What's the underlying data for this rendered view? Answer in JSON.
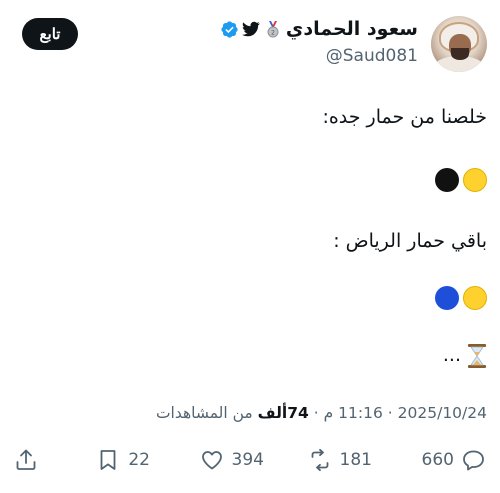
{
  "author": {
    "display_name": "سعود الحمادي",
    "handle": "@Saud081"
  },
  "follow_label": "تابع",
  "tweet": {
    "line1": "خلصنا من حمار جده:",
    "line2": "باقي حمار الرياض :",
    "line3": "..."
  },
  "meta": {
    "time": "11:16 م",
    "separator": "·",
    "date": "2025/10/24",
    "views_count": "74ألف",
    "views_label": "من المشاهدات"
  },
  "actions": {
    "replies": "660",
    "retweets": "181",
    "likes": "394",
    "bookmarks": "22"
  },
  "colors": {
    "text": "#0f1419",
    "secondary": "#536471",
    "verified": "#1d9bf0",
    "button_bg": "#0f1419"
  },
  "icons": [
    "verified-badge-icon",
    "twitter-bird-icon",
    "silver-medal-icon",
    "reply-icon",
    "retweet-icon",
    "like-icon",
    "bookmark-icon",
    "share-icon",
    "hourglass-icon"
  ]
}
